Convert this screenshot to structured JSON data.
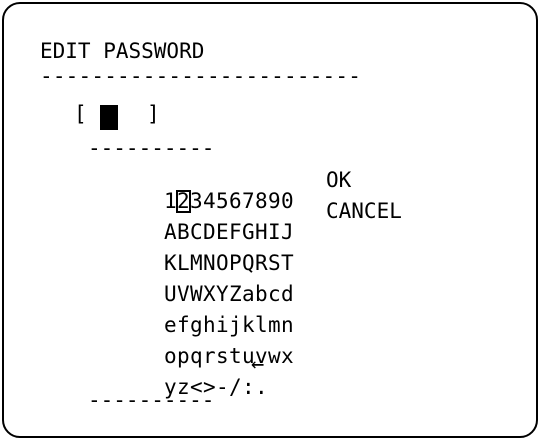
{
  "title": "EDIT PASSWORD",
  "rule_top": "-------------------------",
  "password": {
    "open_bracket": "[",
    "close_bracket": "]"
  },
  "rule_short": "----------",
  "keyboard": {
    "rows": [
      [
        "1",
        "2",
        "3",
        "4",
        "5",
        "6",
        "7",
        "8",
        "9",
        "0"
      ],
      [
        "A",
        "B",
        "C",
        "D",
        "E",
        "F",
        "G",
        "H",
        "I",
        "J"
      ],
      [
        "K",
        "L",
        "M",
        "N",
        "O",
        "P",
        "Q",
        "R",
        "S",
        "T"
      ],
      [
        "U",
        "V",
        "W",
        "X",
        "Y",
        "Z",
        "a",
        "b",
        "c",
        "d"
      ],
      [
        "e",
        "f",
        "g",
        "h",
        "i",
        "j",
        "k",
        "l",
        "m",
        "n"
      ],
      [
        "o",
        "p",
        "q",
        "r",
        "s",
        "t",
        "u",
        "v",
        "w",
        "x"
      ],
      [
        "y",
        "z",
        "<",
        ">",
        "-",
        "/",
        ":",
        "."
      ]
    ],
    "selected": "2"
  },
  "actions": {
    "ok_label": "OK",
    "cancel_label": "CANCEL"
  },
  "backspace_arrow": "←"
}
